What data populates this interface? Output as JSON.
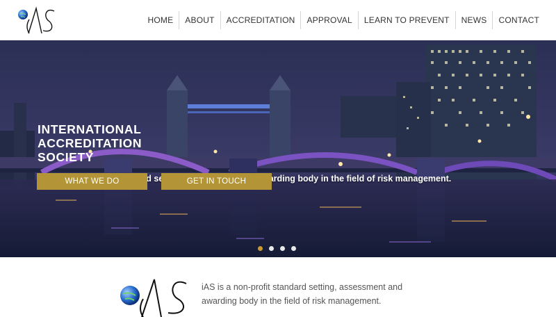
{
  "header": {
    "logo_text": "iAS",
    "nav": [
      {
        "label": "HOME"
      },
      {
        "label": "ABOUT"
      },
      {
        "label": "ACCREDITATION"
      },
      {
        "label": "APPROVAL"
      },
      {
        "label": "LEARN TO PREVENT"
      },
      {
        "label": "NEWS"
      },
      {
        "label": "CONTACT"
      }
    ]
  },
  "hero": {
    "title_lines": [
      "INTERNATIONAL",
      "ACCREDITATION",
      "SOCIETY"
    ],
    "subtitle": "iAS is a non-profit standard setting, assessment and awarding body in the field of risk management.",
    "buttons": {
      "what_we_do": "WHAT WE DO",
      "get_in_touch": "GET IN TOUCH"
    },
    "slider": {
      "count": 4,
      "active": 1
    },
    "colors": {
      "button": "#b39538",
      "active_dot": "#c99a2e"
    }
  },
  "intro": {
    "logo_text": "iAS",
    "text": "iAS is a non-profit standard setting, assessment and awarding body in the field of risk management."
  }
}
